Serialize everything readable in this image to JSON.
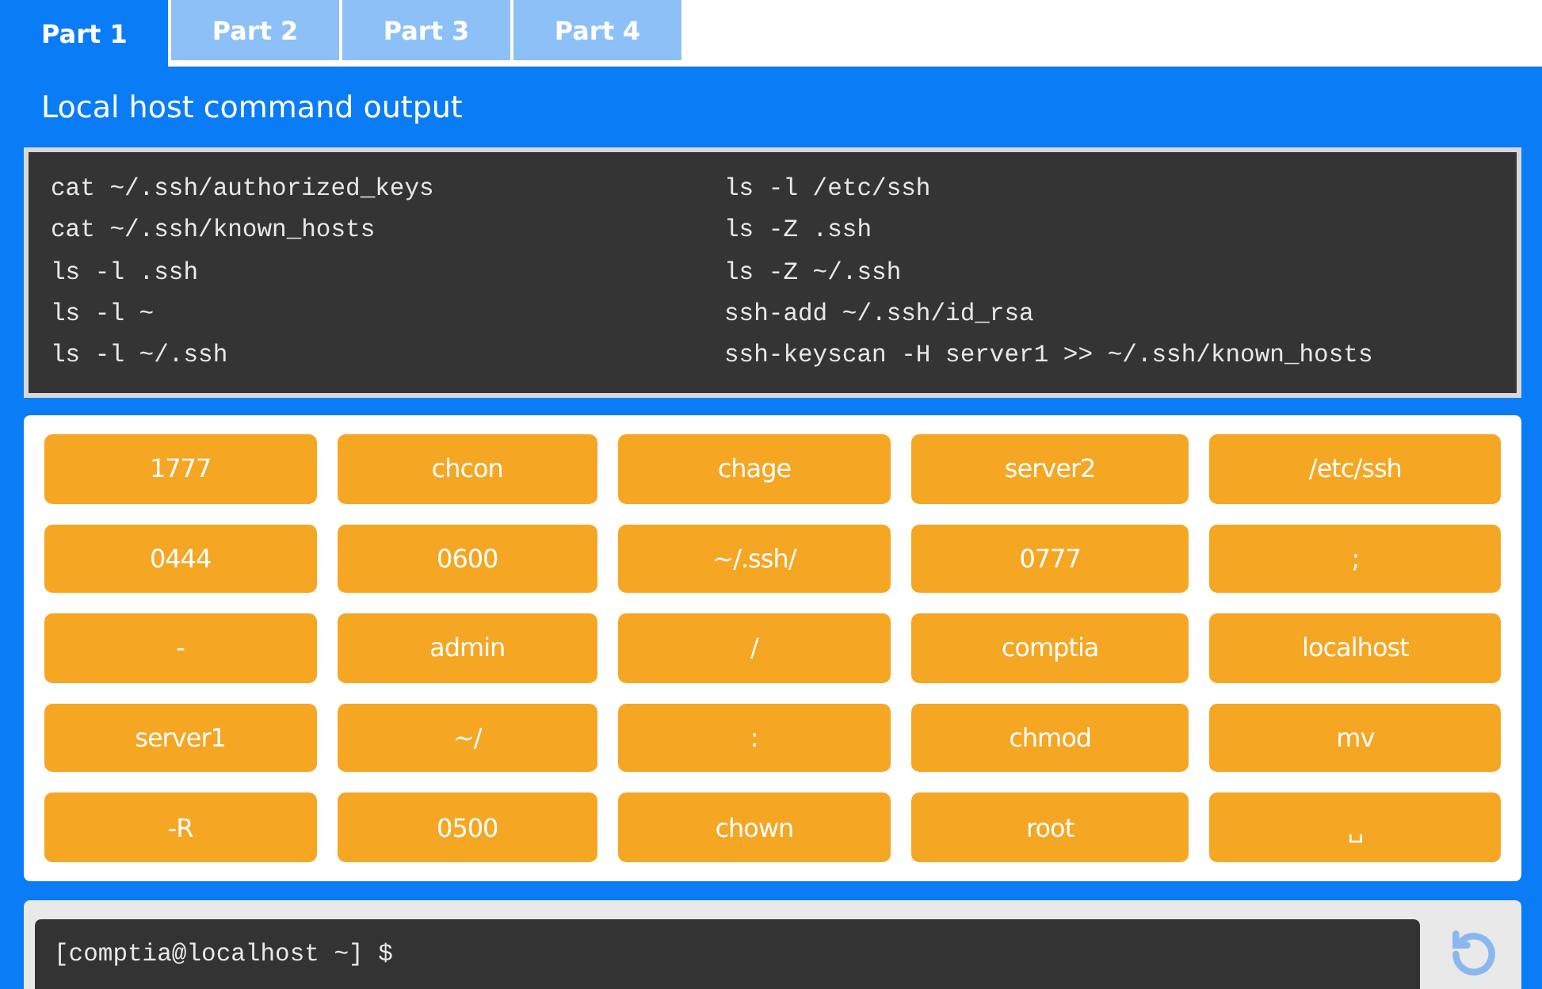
{
  "tabs": [
    {
      "label": "Part 1",
      "selected": true
    },
    {
      "label": "Part 2",
      "selected": false
    },
    {
      "label": "Part 3",
      "selected": false
    },
    {
      "label": "Part 4",
      "selected": false
    }
  ],
  "section_title": "Local host command output",
  "output_columns": [
    [
      "cat ~/.ssh/authorized_keys",
      "cat ~/.ssh/known_hosts",
      "ls -l .ssh",
      "ls -l ~",
      "ls -l ~/.ssh"
    ],
    [
      "ls -l /etc/ssh",
      "ls -Z .ssh",
      "ls -Z ~/.ssh",
      "ssh-add ~/.ssh/id_rsa",
      "ssh-keyscan -H server1 >> ~/.ssh/known_hosts"
    ]
  ],
  "tokens": [
    "1777",
    "chcon",
    "chage",
    "server2",
    "/etc/ssh",
    "0444",
    "0600",
    "~/.ssh/",
    "0777",
    ";",
    "-",
    "admin",
    "/",
    "comptia",
    "localhost",
    "server1",
    "~/",
    ":",
    "chmod",
    "mv",
    "-R",
    "0500",
    "chown",
    "root",
    "␣"
  ],
  "prompt": "[comptia@localhost ~] $"
}
